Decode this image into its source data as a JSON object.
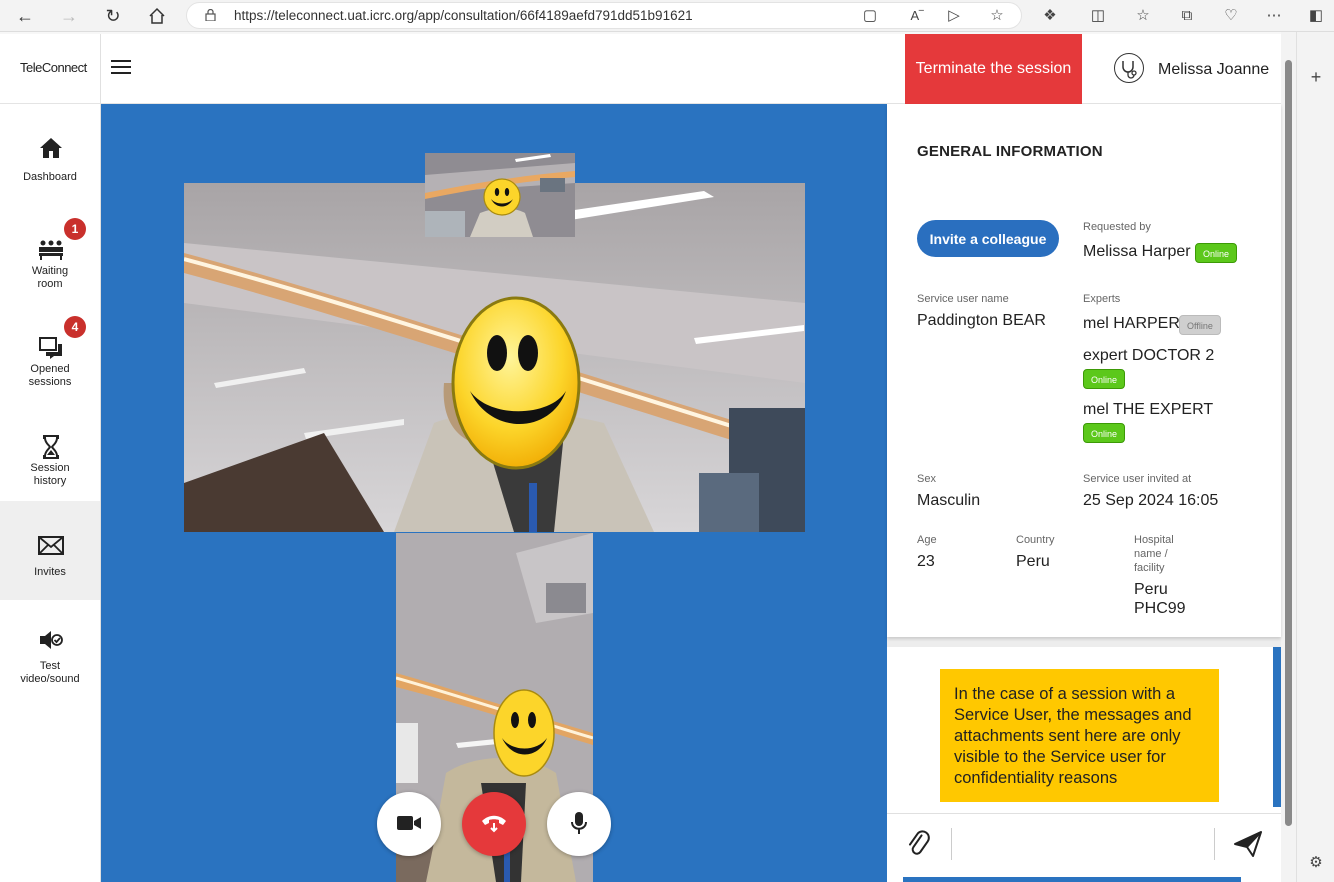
{
  "browser": {
    "url": "https://teleconnect.uat.icrc.org/app/consultation/66f4189aefd791dd51b91621"
  },
  "app": {
    "logo": "TeleConnect",
    "terminate_label": "Terminate the session",
    "user_name": "Melissa Joanne"
  },
  "sidebar": {
    "items": [
      {
        "label": "Dashboard",
        "icon": "home-icon"
      },
      {
        "label": "Waiting room",
        "icon": "waiting-room-icon",
        "badge": "1"
      },
      {
        "label": "Opened sessions",
        "icon": "chat-icon",
        "badge": "4"
      },
      {
        "label": "Session history",
        "icon": "hourglass-icon"
      },
      {
        "label": "Invites",
        "icon": "envelope-icon"
      },
      {
        "label": "Test video/sound",
        "icon": "speaker-check-icon"
      }
    ]
  },
  "info": {
    "title": "GENERAL INFORMATION",
    "invite_label": "Invite a colleague",
    "requested_by_label": "Requested by",
    "requested_by": "Melissa Harper",
    "requested_by_status": "Online",
    "service_user_label": "Service user name",
    "service_user": "Paddington BEAR",
    "experts_label": "Experts",
    "experts": [
      {
        "name": "mel HARPER",
        "status": "Offline"
      },
      {
        "name": "expert DOCTOR 2",
        "status": "Online"
      },
      {
        "name": "mel THE EXPERT",
        "status": "Online"
      }
    ],
    "sex_label": "Sex",
    "sex": "Masculin",
    "invited_at_label": "Service user invited at",
    "invited_at": "25 Sep 2024 16:05",
    "age_label": "Age",
    "age": "23",
    "country_label": "Country",
    "country": "Peru",
    "hospital_label_1": "Hospital",
    "hospital_label_2": "name /",
    "hospital_label_3": "facility",
    "hospital_1": "Peru",
    "hospital_2": "PHC99"
  },
  "chat": {
    "notice": "In the case of a session with a Service User, the messages and attachments sent here are only visible to the Service user for confidentiality reasons",
    "input_placeholder": ""
  },
  "colors": {
    "video_bg": "#2a73c0",
    "terminate": "#e5393b",
    "online": "#5cc81b",
    "notice": "#ffc800",
    "invite": "#2a6fbf"
  }
}
